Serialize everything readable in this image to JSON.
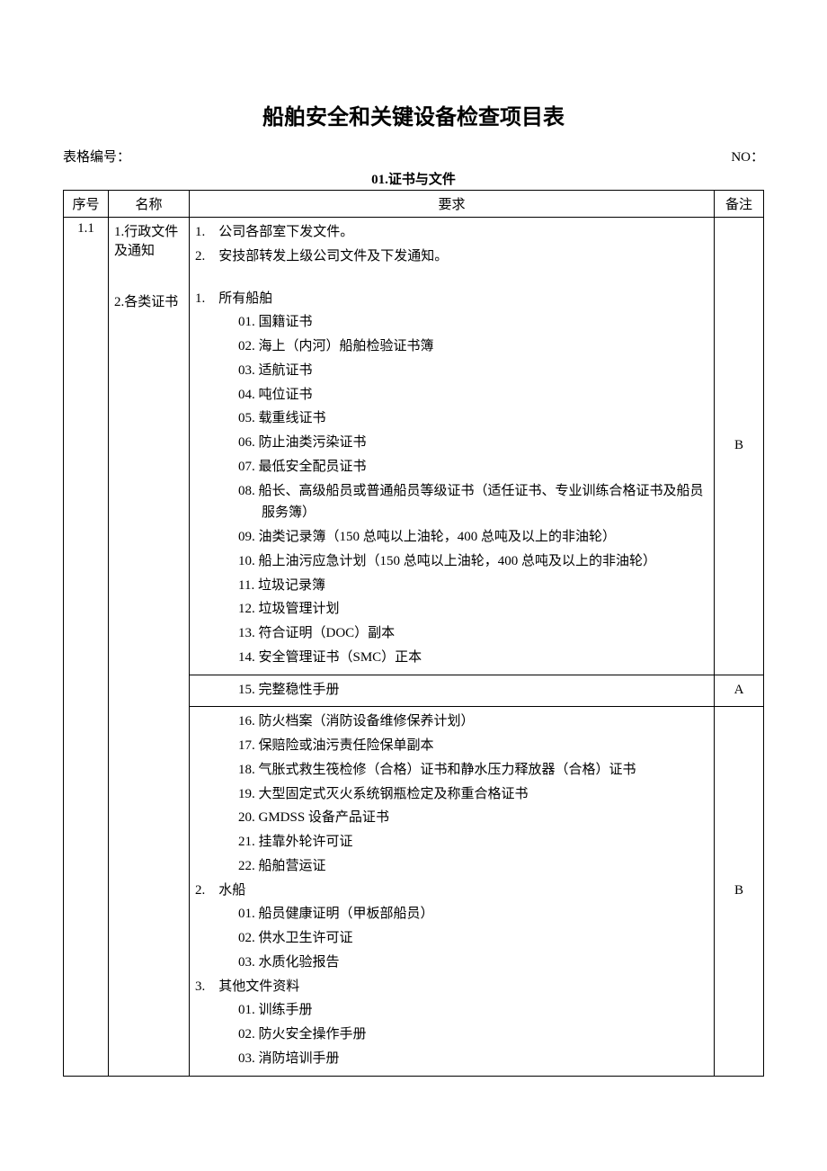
{
  "title": "船舶安全和关键设备检查项目表",
  "meta": {
    "form_no_label": "表格编号：",
    "form_no_value": "",
    "no_label": "NO：",
    "no_value": ""
  },
  "section": "01.证书与文件",
  "headers": {
    "seq": "序号",
    "name": "名称",
    "req": "要求",
    "note": "备注"
  },
  "rows": {
    "seq": "1.1",
    "name_items": {
      "a": "1.行政文件及通知",
      "b": "2.各类证书"
    },
    "block1": {
      "l1": "1.　公司各部室下发文件。",
      "l2": "2.　安技部转发上级公司文件及下发通知。"
    },
    "block2": {
      "g1": "1.　所有船舶",
      "i01": "01. 国籍证书",
      "i02": "02. 海上（内河）船舶检验证书簿",
      "i03": "03. 适航证书",
      "i04": "04. 吨位证书",
      "i05": "05. 载重线证书",
      "i06": "06. 防止油类污染证书",
      "i07": "07. 最低安全配员证书",
      "i08": "08. 船长、高级船员或普通船员等级证书（适任证书、专业训练合格证书及船员服务簿）",
      "i09": "09. 油类记录簿（150 总吨以上油轮，400 总吨及以上的非油轮）",
      "i10": "10. 船上油污应急计划（150 总吨以上油轮，400 总吨及以上的非油轮）",
      "i11": "11. 垃圾记录簿",
      "i12": "12. 垃圾管理计划",
      "i13": "13. 符合证明（DOC）副本",
      "i14": "14. 安全管理证书（SMC）正本",
      "i15": "15. 完整稳性手册",
      "i16": "16. 防火档案（消防设备维修保养计划）",
      "i17": "17. 保赔险或油污责任险保单副本",
      "i18": "18. 气胀式救生筏检修（合格）证书和静水压力释放器（合格）证书",
      "i19": "19. 大型固定式灭火系统钢瓶检定及称重合格证书",
      "i20": "20. GMDSS 设备产品证书",
      "i21": "21. 挂靠外轮许可证",
      "i22": "22. 船舶营运证",
      "g2": "2.　水船",
      "w01": "01.  船员健康证明（甲板部船员）",
      "w02": "02.  供水卫生许可证",
      "w03": "03.  水质化验报告",
      "g3": "3.　其他文件资料",
      "o01": "01. 训练手册",
      "o02": "02. 防火安全操作手册",
      "o03": "03. 消防培训手册"
    },
    "notes": {
      "n1": "B",
      "n2": "A",
      "n3": "B"
    }
  }
}
